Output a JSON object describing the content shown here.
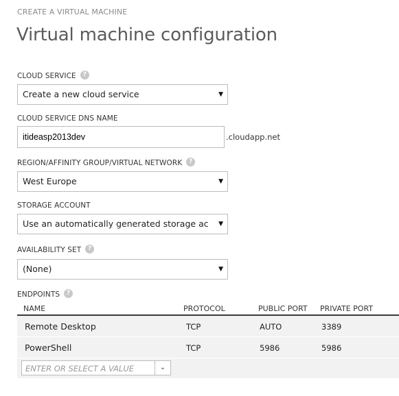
{
  "breadcrumb": "CREATE A VIRTUAL MACHINE",
  "title": "Virtual machine configuration",
  "help_glyph": "?",
  "cloud_service": {
    "label": "CLOUD SERVICE",
    "value": "Create a new cloud service"
  },
  "dns_name": {
    "label": "CLOUD SERVICE DNS NAME",
    "value": "itideasp2013dev",
    "suffix": ".cloudapp.net"
  },
  "region": {
    "label": "REGION/AFFINITY GROUP/VIRTUAL NETWORK",
    "value": "West Europe"
  },
  "storage": {
    "label": "STORAGE ACCOUNT",
    "value": "Use an automatically generated storage account"
  },
  "availability": {
    "label": "AVAILABILITY SET",
    "value": "(None)"
  },
  "endpoints": {
    "label": "ENDPOINTS",
    "columns": [
      "NAME",
      "PROTOCOL",
      "PUBLIC PORT",
      "PRIVATE PORT"
    ],
    "rows": [
      [
        "Remote Desktop",
        "TCP",
        "AUTO",
        "3389"
      ],
      [
        "PowerShell",
        "TCP",
        "5986",
        "5986"
      ]
    ],
    "add_placeholder": "ENTER OR SELECT A VALUE"
  },
  "icons": {
    "dropdown": "caret-down-icon",
    "combo": "chevron-down-icon",
    "help": "help-icon"
  },
  "colors": {
    "title": "#5b5b5b",
    "table_bg": "#f2f2f2",
    "header_rule": "#3a3a3a"
  }
}
